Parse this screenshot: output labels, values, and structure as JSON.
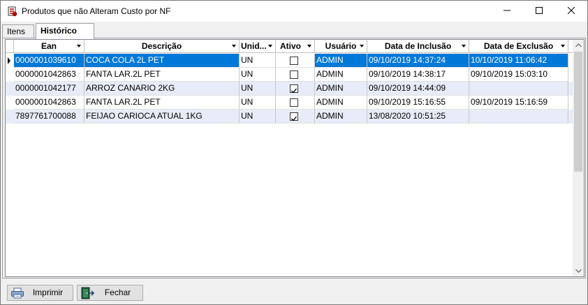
{
  "window": {
    "title": "Produtos que não Alteram Custo por NF"
  },
  "tabs": [
    {
      "label": "Itens",
      "active": false
    },
    {
      "label": "Histórico",
      "active": true
    }
  ],
  "grid": {
    "columns": [
      {
        "label": "Ean"
      },
      {
        "label": "Descrição"
      },
      {
        "label": "Unid..."
      },
      {
        "label": "Ativo"
      },
      {
        "label": "Usuário"
      },
      {
        "label": "Data de Inclusão"
      },
      {
        "label": "Data de Exclusão"
      }
    ],
    "rows": [
      {
        "ean": "0000001039610",
        "descricao": "COCA COLA 2L PET",
        "unid": "UN",
        "ativo": false,
        "usuario": "ADMIN",
        "inclusao": "09/10/2019 14:37:24",
        "exclusao": "10/10/2019 11:06:42",
        "selected": true
      },
      {
        "ean": "0000001042863",
        "descricao": "FANTA LAR.2L PET",
        "unid": "UN",
        "ativo": false,
        "usuario": "ADMIN",
        "inclusao": "09/10/2019 14:38:17",
        "exclusao": "09/10/2019 15:03:10",
        "selected": false
      },
      {
        "ean": "0000001042177",
        "descricao": "ARROZ CANARIO 2KG",
        "unid": "UN",
        "ativo": true,
        "usuario": "ADMIN",
        "inclusao": "09/10/2019 14:44:09",
        "exclusao": "",
        "selected": false
      },
      {
        "ean": "0000001042863",
        "descricao": "FANTA LAR.2L PET",
        "unid": "UN",
        "ativo": false,
        "usuario": "ADMIN",
        "inclusao": "09/10/2019 15:16:55",
        "exclusao": "09/10/2019 15:16:59",
        "selected": false
      },
      {
        "ean": "7897761700088",
        "descricao": "FEIJAO CARIOCA ATUAL 1KG",
        "unid": "UN",
        "ativo": true,
        "usuario": "ADMIN",
        "inclusao": "13/08/2020 10:51:25",
        "exclusao": "",
        "selected": false
      }
    ]
  },
  "buttons": {
    "print_label": "Imprimir",
    "close_label": "Fechar"
  },
  "icons": {
    "app": "app-icon",
    "print": "printer-icon",
    "close": "exit-door-icon"
  },
  "colors": {
    "selection": "#0078d7",
    "alt_row": "#e8ecf8"
  }
}
